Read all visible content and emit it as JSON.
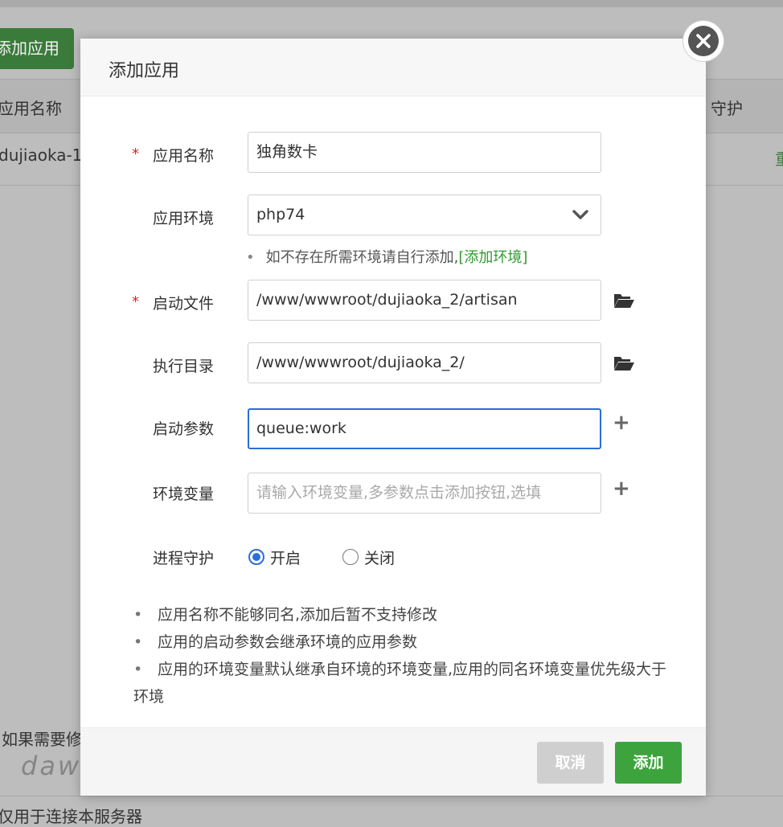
{
  "background": {
    "add_app_button": "添加应用",
    "table_header_name": "应用名称",
    "table_header_guard": "守护",
    "row_name": "dujiaoka-1",
    "row_action": "重",
    "note_1": "如果需要修",
    "note_2": "仅用于连接本服务器",
    "watermark": "dawanka.cn"
  },
  "modal": {
    "title": "添加应用",
    "close_icon": "close-icon",
    "fields": {
      "app_name": {
        "label": "应用名称",
        "value": "独角数卡",
        "required": "*"
      },
      "app_env": {
        "label": "应用环境",
        "value": "php74"
      },
      "env_hint": {
        "text": "如不存在所需环境请自行添加,",
        "link": "[添加环境]"
      },
      "start_file": {
        "label": "启动文件",
        "value": "/www/wwwroot/dujiaoka_2/artisan",
        "required": "*"
      },
      "exec_dir": {
        "label": "执行目录",
        "value": "/www/wwwroot/dujiaoka_2/"
      },
      "start_args": {
        "label": "启动参数",
        "value": "queue:work"
      },
      "env_vars": {
        "label": "环境变量",
        "placeholder": "请输入环境变量,多参数点击添加按钮,选填"
      },
      "daemon": {
        "label": "进程守护",
        "on_label": "开启",
        "off_label": "关闭",
        "selected": "开启"
      }
    },
    "notes": [
      "应用名称不能够同名,添加后暂不支持修改",
      "应用的启动参数会继承环境的应用参数",
      "应用的环境变量默认继承自环境的环境变量,应用的同名环境变量优先级大于环境"
    ],
    "buttons": {
      "cancel": "取消",
      "submit": "添加"
    }
  },
  "colors": {
    "primary_green": "#3da33d",
    "focus_blue": "#2a6ed8",
    "required_red": "#e02020"
  }
}
